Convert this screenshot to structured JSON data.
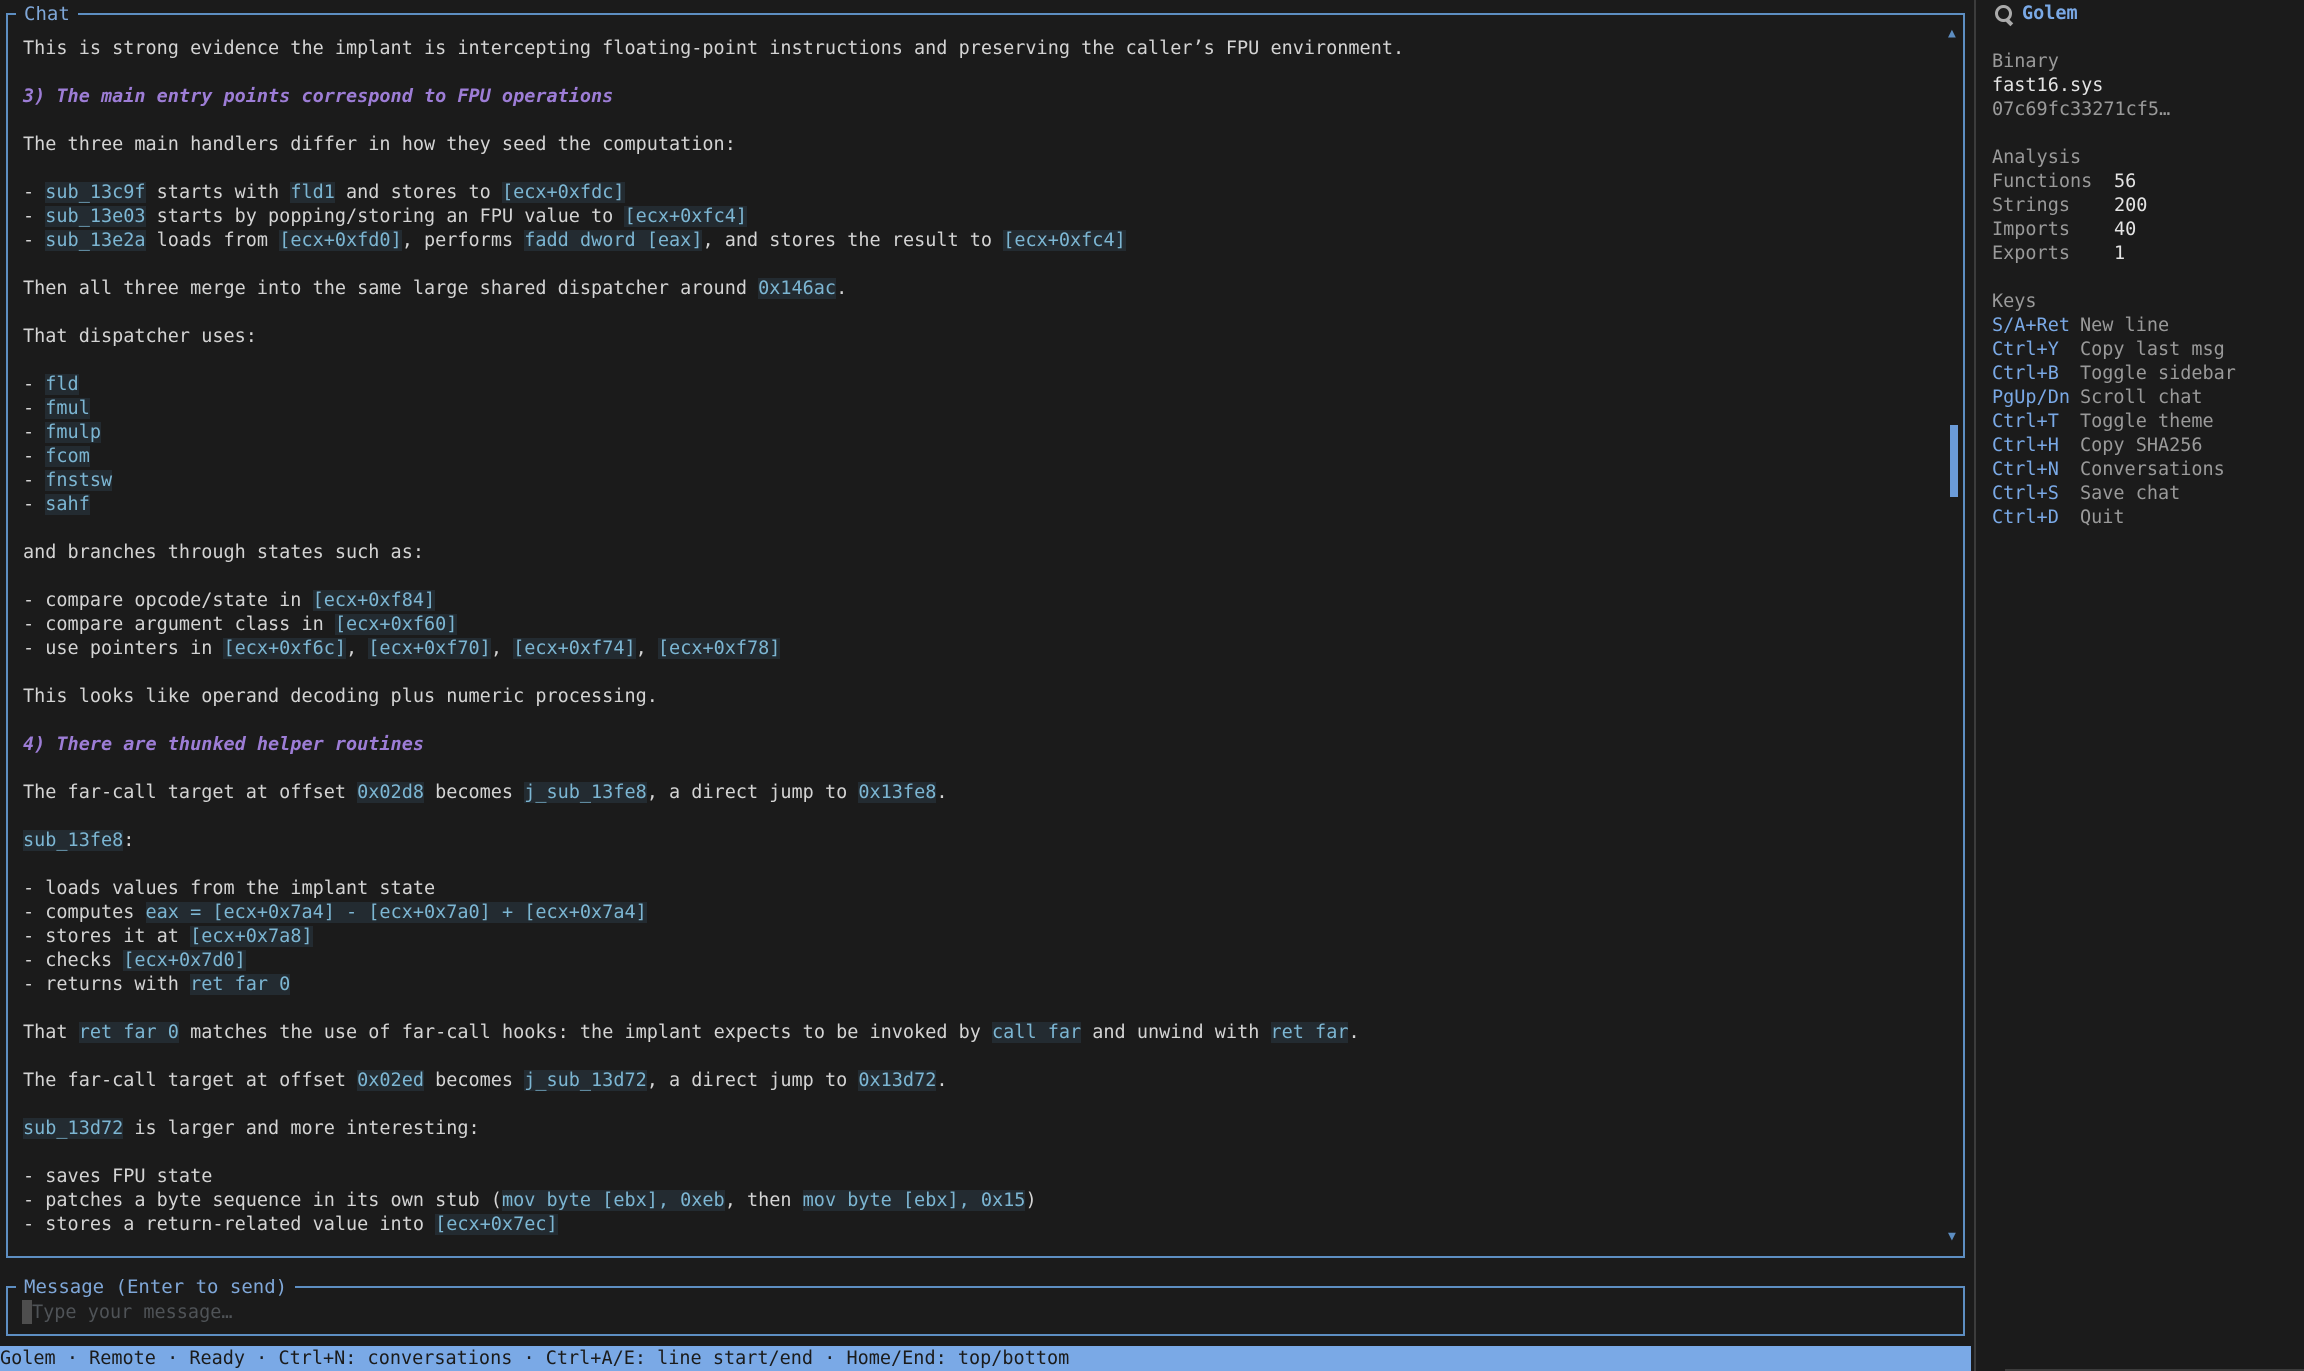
{
  "chat": {
    "title": "Chat",
    "lines": [
      [
        {
          "t": "This is strong evidence the implant is intercepting floating-point instructions and preserving the caller’s FPU environment."
        }
      ],
      [],
      [
        {
          "t": "3) The main entry points correspond to FPU operations",
          "s": "hd"
        }
      ],
      [],
      [
        {
          "t": "The three main handlers differ in how they seed the computation:"
        }
      ],
      [],
      [
        {
          "t": "- "
        },
        {
          "t": "sub_13c9f",
          "s": "cd"
        },
        {
          "t": " starts with "
        },
        {
          "t": "fld1",
          "s": "cd"
        },
        {
          "t": " and stores to "
        },
        {
          "t": "[ecx+0xfdc]",
          "s": "cd"
        }
      ],
      [
        {
          "t": "- "
        },
        {
          "t": "sub_13e03",
          "s": "cd"
        },
        {
          "t": " starts by popping/storing an FPU value to "
        },
        {
          "t": "[ecx+0xfc4]",
          "s": "cd"
        }
      ],
      [
        {
          "t": "- "
        },
        {
          "t": "sub_13e2a",
          "s": "cd"
        },
        {
          "t": " loads from "
        },
        {
          "t": "[ecx+0xfd0]",
          "s": "cd"
        },
        {
          "t": ", performs "
        },
        {
          "t": "fadd dword [eax]",
          "s": "cd"
        },
        {
          "t": ", and stores the result to "
        },
        {
          "t": "[ecx+0xfc4]",
          "s": "cd"
        }
      ],
      [],
      [
        {
          "t": "Then all three merge into the same large shared dispatcher around "
        },
        {
          "t": "0x146ac",
          "s": "cd"
        },
        {
          "t": "."
        }
      ],
      [],
      [
        {
          "t": "That dispatcher uses:"
        }
      ],
      [],
      [
        {
          "t": "- "
        },
        {
          "t": "fld",
          "s": "cd"
        }
      ],
      [
        {
          "t": "- "
        },
        {
          "t": "fmul",
          "s": "cd"
        }
      ],
      [
        {
          "t": "- "
        },
        {
          "t": "fmulp",
          "s": "cd"
        }
      ],
      [
        {
          "t": "- "
        },
        {
          "t": "fcom",
          "s": "cd"
        }
      ],
      [
        {
          "t": "- "
        },
        {
          "t": "fnstsw",
          "s": "cd"
        }
      ],
      [
        {
          "t": "- "
        },
        {
          "t": "sahf",
          "s": "cd"
        }
      ],
      [],
      [
        {
          "t": "and branches through states such as:"
        }
      ],
      [],
      [
        {
          "t": "- compare opcode/state in "
        },
        {
          "t": "[ecx+0xf84]",
          "s": "cd"
        }
      ],
      [
        {
          "t": "- compare argument class in "
        },
        {
          "t": "[ecx+0xf60]",
          "s": "cd"
        }
      ],
      [
        {
          "t": "- use pointers in "
        },
        {
          "t": "[ecx+0xf6c]",
          "s": "cd"
        },
        {
          "t": ", "
        },
        {
          "t": "[ecx+0xf70]",
          "s": "cd"
        },
        {
          "t": ", "
        },
        {
          "t": "[ecx+0xf74]",
          "s": "cd"
        },
        {
          "t": ", "
        },
        {
          "t": "[ecx+0xf78]",
          "s": "cd"
        }
      ],
      [],
      [
        {
          "t": "This looks like operand decoding plus numeric processing."
        }
      ],
      [],
      [
        {
          "t": "4) There are thunked helper routines",
          "s": "hd"
        }
      ],
      [],
      [
        {
          "t": "The far-call target at offset "
        },
        {
          "t": "0x02d8",
          "s": "cd"
        },
        {
          "t": " becomes "
        },
        {
          "t": "j_sub_13fe8",
          "s": "cd"
        },
        {
          "t": ", a direct jump to "
        },
        {
          "t": "0x13fe8",
          "s": "cd"
        },
        {
          "t": "."
        }
      ],
      [],
      [
        {
          "t": "sub_13fe8",
          "s": "cd"
        },
        {
          "t": ":"
        }
      ],
      [],
      [
        {
          "t": "- loads values from the implant state"
        }
      ],
      [
        {
          "t": "- computes "
        },
        {
          "t": "eax = [ecx+0x7a4] - [ecx+0x7a0] + [ecx+0x7a4]",
          "s": "cd"
        }
      ],
      [
        {
          "t": "- stores it at "
        },
        {
          "t": "[ecx+0x7a8]",
          "s": "cd"
        }
      ],
      [
        {
          "t": "- checks "
        },
        {
          "t": "[ecx+0x7d0]",
          "s": "cd"
        }
      ],
      [
        {
          "t": "- returns with "
        },
        {
          "t": "ret far 0",
          "s": "cd"
        }
      ],
      [],
      [
        {
          "t": "That "
        },
        {
          "t": "ret far 0",
          "s": "cd"
        },
        {
          "t": " matches the use of far-call hooks: the implant expects to be invoked by "
        },
        {
          "t": "call far",
          "s": "cd"
        },
        {
          "t": " and unwind with "
        },
        {
          "t": "ret far",
          "s": "cd"
        },
        {
          "t": "."
        }
      ],
      [],
      [
        {
          "t": "The far-call target at offset "
        },
        {
          "t": "0x02ed",
          "s": "cd"
        },
        {
          "t": " becomes "
        },
        {
          "t": "j_sub_13d72",
          "s": "cd"
        },
        {
          "t": ", a direct jump to "
        },
        {
          "t": "0x13d72",
          "s": "cd"
        },
        {
          "t": "."
        }
      ],
      [],
      [
        {
          "t": "sub_13d72",
          "s": "cd"
        },
        {
          "t": " is larger and more interesting:"
        }
      ],
      [],
      [
        {
          "t": "- saves FPU state"
        }
      ],
      [
        {
          "t": "- patches a byte sequence in its own stub ("
        },
        {
          "t": "mov byte [ebx], 0xeb",
          "s": "cd"
        },
        {
          "t": ", then "
        },
        {
          "t": "mov byte [ebx], 0x15",
          "s": "cd"
        },
        {
          "t": ")"
        }
      ],
      [
        {
          "t": "- stores a return-related value into "
        },
        {
          "t": "[ecx+0x7ec]",
          "s": "cd"
        }
      ]
    ]
  },
  "scrollbar": {
    "up_icon": "▲",
    "down_icon": "▼"
  },
  "message": {
    "title": "Message (Enter to send)",
    "placeholder": "Type your message…",
    "value": ""
  },
  "status_bar": "Golem · Remote · Ready · Ctrl+N: conversations · Ctrl+A/E: line start/end · Home/End: top/bottom",
  "sidebar": {
    "title": "Golem",
    "binary": {
      "label": "Binary",
      "filename": "fast16.sys",
      "hash": "07c69fc33271cf5…"
    },
    "analysis": {
      "label": "Analysis",
      "stats": [
        {
          "name": "Functions",
          "value": "56"
        },
        {
          "name": "Strings",
          "value": "200"
        },
        {
          "name": "Imports",
          "value": "40"
        },
        {
          "name": "Exports",
          "value": "1"
        }
      ]
    },
    "keys": {
      "label": "Keys",
      "items": [
        {
          "key": "S/A+Ret",
          "desc": "New line"
        },
        {
          "key": "Ctrl+Y",
          "desc": "Copy last msg"
        },
        {
          "key": "Ctrl+B",
          "desc": "Toggle sidebar"
        },
        {
          "key": "PgUp/Dn",
          "desc": "Scroll chat"
        },
        {
          "key": "Ctrl+T",
          "desc": "Toggle theme"
        },
        {
          "key": "Ctrl+H",
          "desc": "Copy SHA256"
        },
        {
          "key": "Ctrl+N",
          "desc": "Conversations"
        },
        {
          "key": "Ctrl+S",
          "desc": "Save chat"
        },
        {
          "key": "Ctrl+D",
          "desc": "Quit"
        }
      ]
    }
  },
  "colors": {
    "background": "#1b1b1b",
    "accent": "#7aa9e6",
    "border": "#5d8ec2",
    "heading": "#9d7dd6",
    "code_fg": "#7cb6d3",
    "code_bg": "#232b31"
  }
}
